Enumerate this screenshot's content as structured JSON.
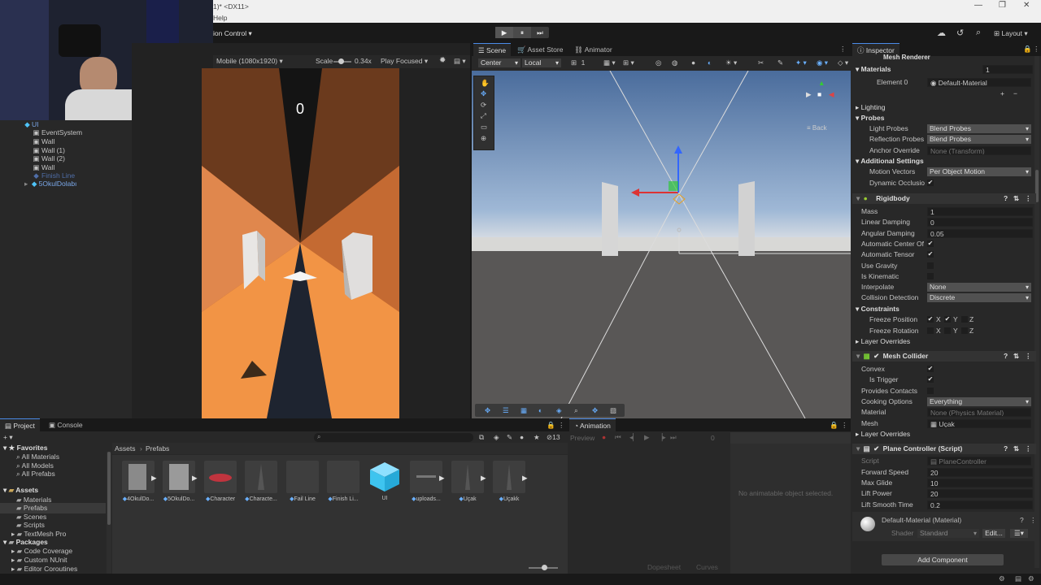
{
  "window": {
    "title": "1)* <DX11>",
    "menu_help": "Help",
    "win_controls": [
      "—",
      "❐",
      "✕"
    ]
  },
  "toolbar": {
    "version_control": "ion Control",
    "play": "▶",
    "pause": "⏸",
    "step": "⏭",
    "layout": "Layout"
  },
  "game_view": {
    "resolution": "Mobile (1080x1920)",
    "scale_label": "Scale",
    "scale_value": "0.34x",
    "play_mode": "Play Focused",
    "score": "0"
  },
  "hierarchy": {
    "items": [
      {
        "label": "UI",
        "color": "#7aa7e8"
      },
      {
        "label": "EventSystem",
        "color": "#c4c4c4"
      },
      {
        "label": "Wall",
        "color": "#c4c4c4"
      },
      {
        "label": "Wall (1)",
        "color": "#c4c4c4"
      },
      {
        "label": "Wall (2)",
        "color": "#c4c4c4"
      },
      {
        "label": "Wall",
        "color": "#c4c4c4"
      },
      {
        "label": "Finish Line",
        "color": "#4f6ea8"
      },
      {
        "label": "5OkulDolabı",
        "color": "#7aa7e8"
      }
    ]
  },
  "scene_view": {
    "tabs": [
      "Scene",
      "Asset Store",
      "Animator"
    ],
    "pivot": "Center",
    "space": "Local",
    "snap_value": "1",
    "back_label": "≡ Back"
  },
  "inspector": {
    "tab": "Inspector",
    "mesh_renderer": "Mesh Renderer",
    "materials": {
      "label": "Materials",
      "count": "1",
      "element": "Element 0",
      "value": "Default-Material"
    },
    "lighting": "Lighting",
    "probes": "Probes",
    "light_probes": {
      "label": "Light Probes",
      "value": "Blend Probes"
    },
    "reflection_probes": {
      "label": "Reflection Probes",
      "value": "Blend Probes"
    },
    "anchor_override": {
      "label": "Anchor Override",
      "value": "None (Transform)"
    },
    "additional_settings": "Additional Settings",
    "motion_vectors": {
      "label": "Motion Vectors",
      "value": "Per Object Motion"
    },
    "dynamic_occlusion": {
      "label": "Dynamic Occlusio",
      "checked": true
    },
    "rigidbody": {
      "title": "Rigidbody",
      "mass": {
        "label": "Mass",
        "value": "1"
      },
      "linear_damping": {
        "label": "Linear Damping",
        "value": "0"
      },
      "angular_damping": {
        "label": "Angular Damping",
        "value": "0.05"
      },
      "auto_center": {
        "label": "Automatic Center Of",
        "checked": true
      },
      "auto_tensor": {
        "label": "Automatic Tensor",
        "checked": true
      },
      "use_gravity": {
        "label": "Use Gravity",
        "checked": false
      },
      "is_kinematic": {
        "label": "Is Kinematic",
        "checked": false
      },
      "interpolate": {
        "label": "Interpolate",
        "value": "None"
      },
      "collision_detection": {
        "label": "Collision Detection",
        "value": "Discrete"
      },
      "constraints": "Constraints",
      "freeze_position": {
        "label": "Freeze Position",
        "x": "X",
        "y": "Y",
        "z": "Z"
      },
      "freeze_rotation": {
        "label": "Freeze Rotation",
        "x": "X",
        "y": "Y",
        "z": "Z"
      },
      "layer_overrides": "Layer Overrides"
    },
    "mesh_collider": {
      "title": "Mesh Collider",
      "convex": {
        "label": "Convex",
        "checked": true
      },
      "is_trigger": {
        "label": "Is Trigger",
        "checked": true
      },
      "provides_contacts": {
        "label": "Provides Contacts",
        "checked": false
      },
      "cooking_options": {
        "label": "Cooking Options",
        "value": "Everything"
      },
      "material": {
        "label": "Material",
        "value": "None (Physics Material)"
      },
      "mesh": {
        "label": "Mesh",
        "value": "Uçak"
      },
      "layer_overrides": "Layer Overrides"
    },
    "plane_controller": {
      "title": "Plane Controller (Script)",
      "script": {
        "label": "Script",
        "value": "PlaneController"
      },
      "forward_speed": {
        "label": "Forward Speed",
        "value": "20"
      },
      "max_glide": {
        "label": "Max Glide",
        "value": "10"
      },
      "lift_power": {
        "label": "Lift Power",
        "value": "20"
      },
      "lift_smooth_time": {
        "label": "Lift Smooth Time",
        "value": "0.2"
      }
    },
    "material_preview": {
      "title": "Default-Material (Material)",
      "shader_label": "Shader",
      "shader_value": "Standard",
      "edit": "Edit..."
    },
    "add_component": "Add Component"
  },
  "project": {
    "tabs": [
      "Project",
      "Console"
    ],
    "favorites": {
      "title": "Favorites",
      "items": [
        "All Materials",
        "All Models",
        "All Prefabs"
      ]
    },
    "assets": {
      "title": "Assets",
      "items": [
        "Materials",
        "Prefabs",
        "Scenes",
        "Scripts",
        "TextMesh Pro"
      ]
    },
    "packages": {
      "title": "Packages",
      "items": [
        "Code Coverage",
        "Custom NUnit",
        "Editor Coroutines"
      ]
    },
    "breadcrumb": [
      "Assets",
      "Prefabs"
    ],
    "hidden_count": "13",
    "prefabs": [
      "4OkulDo...",
      "5OkulDo...",
      "Character",
      "Characte...",
      "Fail Line",
      "Finish Li...",
      "UI",
      "uploads...",
      "Uçak",
      "Uçakk"
    ]
  },
  "animation": {
    "tab": "Animation",
    "preview": "Preview",
    "frame": "0",
    "empty_message": "No animatable object selected.",
    "dopesheet": "Dopesheet",
    "curves": "Curves"
  }
}
